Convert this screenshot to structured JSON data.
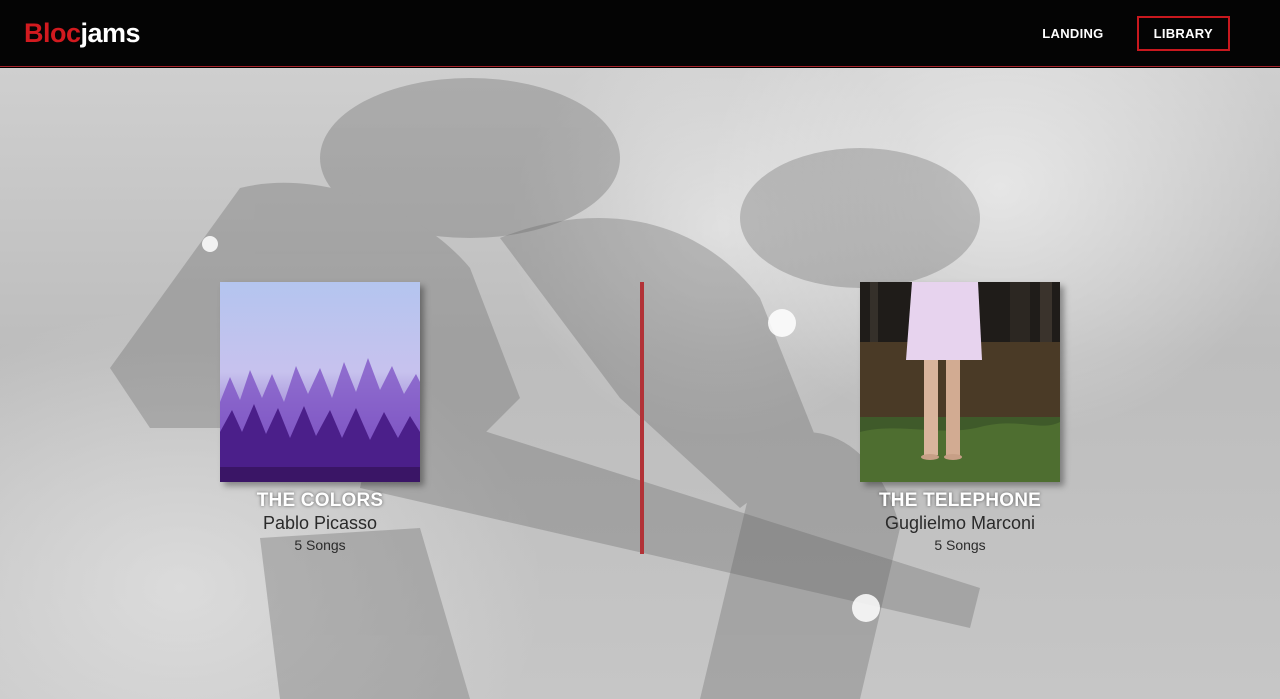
{
  "navbar": {
    "logo_part1": "Bloc",
    "logo_part2": "jams",
    "links": [
      "LANDING",
      "LIBRARY"
    ],
    "active_link": "LIBRARY"
  },
  "albums": [
    {
      "title": "THE COLORS",
      "artist": "Pablo Picasso",
      "song_count": "5 Songs"
    },
    {
      "title": "THE TELEPHONE",
      "artist": "Guglielmo Marconi",
      "song_count": "5 Songs"
    }
  ],
  "colors": {
    "brand_red": "#d21a1f",
    "divider_red": "#b23237",
    "nav_bg": "#040404"
  }
}
